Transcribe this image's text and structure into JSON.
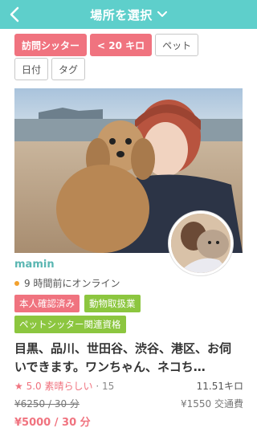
{
  "header": {
    "title": "場所を選択",
    "back_icon": "chevron-left-icon",
    "dropdown_icon": "chevron-down-icon",
    "color": "#5ecfcb"
  },
  "filters": {
    "row1": [
      {
        "label": "訪問シッター",
        "active": true
      },
      {
        "label": "< 20 キロ",
        "active": true
      },
      {
        "label": "ペット",
        "active": false
      }
    ],
    "row2": [
      {
        "label": "日付",
        "active": false
      },
      {
        "label": "タグ",
        "active": false
      }
    ]
  },
  "listing": {
    "name": "mamin",
    "online_status": "9 時間前にオンライン",
    "badges": {
      "identity": "本人確認済み",
      "animal_handler": "動物取扱業",
      "qualification": "ペットシッター関連資格"
    },
    "description": "目黒、品川、世田谷、渋谷、港区、お伺いできます。ワンちゃん、ネコち…",
    "rating": {
      "star": "★",
      "score": "5.0",
      "label": "素晴らしい",
      "separator": " · ",
      "count": "15"
    },
    "distance": "11.51キロ",
    "old_price": "¥6250 / 30 分",
    "transport_fee": "¥1550 交通費",
    "price": "¥5000 / 30 分"
  },
  "colors": {
    "accent": "#5ecfcb",
    "pink": "#f0737f",
    "green": "#8cc63f"
  }
}
